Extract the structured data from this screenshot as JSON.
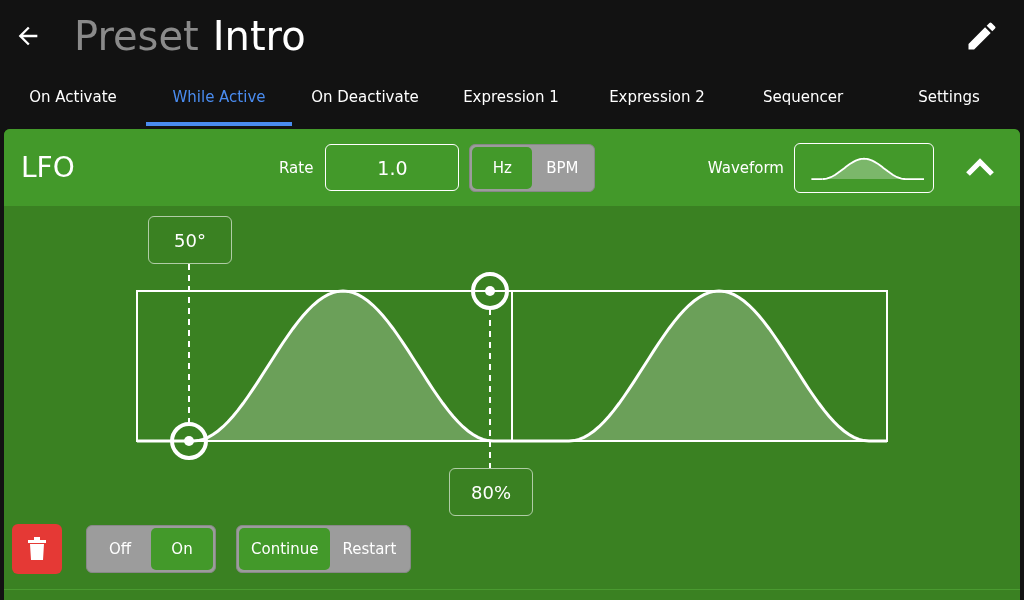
{
  "header": {
    "title_prefix": "Preset",
    "title": "Intro"
  },
  "tabs": [
    {
      "label": "On Activate",
      "selected": false
    },
    {
      "label": "While Active",
      "selected": true
    },
    {
      "label": "On Deactivate",
      "selected": false
    },
    {
      "label": "Expression 1",
      "selected": false
    },
    {
      "label": "Expression 2",
      "selected": false
    },
    {
      "label": "Sequencer",
      "selected": false
    },
    {
      "label": "Settings",
      "selected": false
    }
  ],
  "lfo": {
    "title": "LFO",
    "rate_label": "Rate",
    "rate_value": "1.0",
    "units": [
      {
        "label": "Hz",
        "selected": true
      },
      {
        "label": "BPM",
        "selected": false
      }
    ],
    "waveform_label": "Waveform",
    "phase_label": "50°",
    "depth_label": "80%",
    "power": [
      {
        "label": "Off",
        "selected": false
      },
      {
        "label": "On",
        "selected": true
      }
    ],
    "mode": [
      {
        "label": "Continue",
        "selected": true
      },
      {
        "label": "Restart",
        "selected": false
      }
    ]
  }
}
